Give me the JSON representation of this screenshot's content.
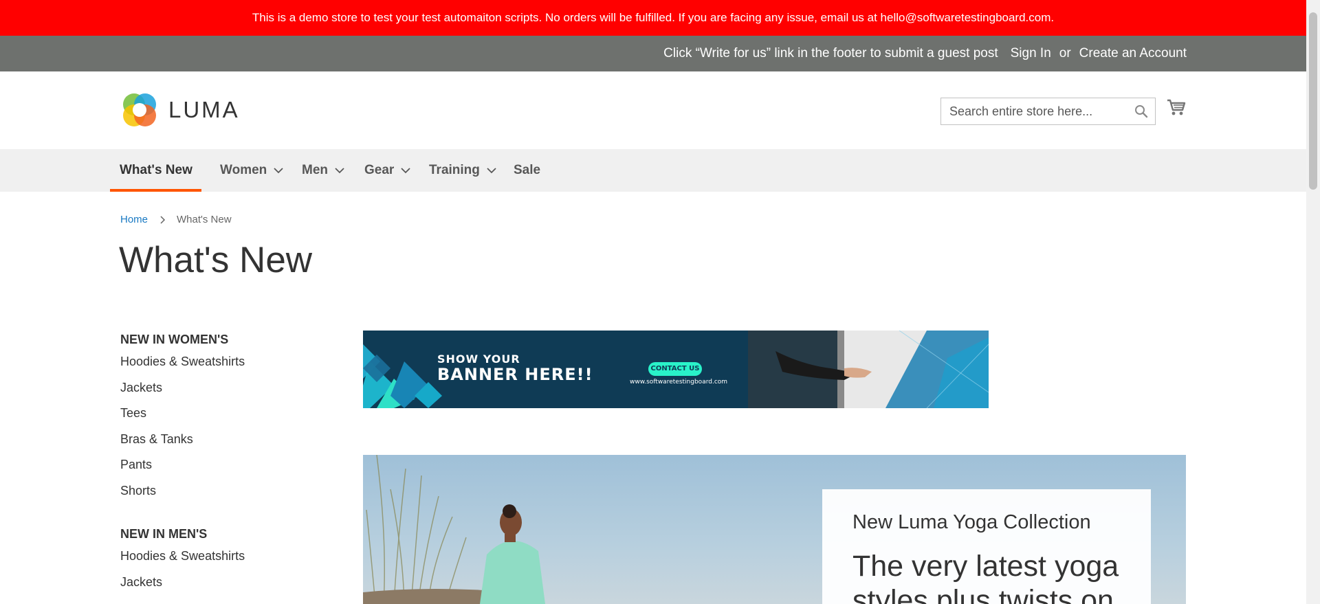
{
  "demo_notice": "This is a demo store to test your test automaiton scripts. No orders will be fulfilled. If you are facing any issue, email us at hello@softwaretestingboard.com.",
  "top_links": {
    "guest_post": "Click “Write for us” link in the footer to submit a guest post",
    "sign_in": "Sign In",
    "or": "or",
    "create_account": "Create an Account"
  },
  "header": {
    "logo_text": "LUMA",
    "search_placeholder": "Search entire store here...",
    "search_icon": "search-icon",
    "cart_icon": "cart-icon"
  },
  "nav": {
    "items": [
      {
        "label": "What's New",
        "has_dropdown": false,
        "active": true
      },
      {
        "label": "Women",
        "has_dropdown": true
      },
      {
        "label": "Men",
        "has_dropdown": true
      },
      {
        "label": "Gear",
        "has_dropdown": true
      },
      {
        "label": "Training",
        "has_dropdown": true
      },
      {
        "label": "Sale",
        "has_dropdown": false
      }
    ],
    "accent_color": "#ff5501"
  },
  "breadcrumb": {
    "home": "Home",
    "current": "What's New"
  },
  "page_title": "What's New",
  "sidebar": {
    "groups": [
      {
        "title": "NEW IN WOMEN'S",
        "links": [
          "Hoodies & Sweatshirts",
          "Jackets",
          "Tees",
          "Bras & Tanks",
          "Pants",
          "Shorts"
        ]
      },
      {
        "title": "NEW IN MEN'S",
        "links": [
          "Hoodies & Sweatshirts",
          "Jackets"
        ]
      }
    ]
  },
  "banner": {
    "line1": "SHOW YOUR",
    "line2": "BANNER HERE!!",
    "button": "CONTACT US",
    "url": "www.softwaretestingboard.com"
  },
  "hero": {
    "subtitle": "New Luma Yoga Collection",
    "headline": "The very latest yoga styles plus twists on"
  },
  "colors": {
    "demo_bar": "#ff0000",
    "top_bar": "#6e716e",
    "nav_bg": "#f0f0f0",
    "link": "#1979c3"
  }
}
